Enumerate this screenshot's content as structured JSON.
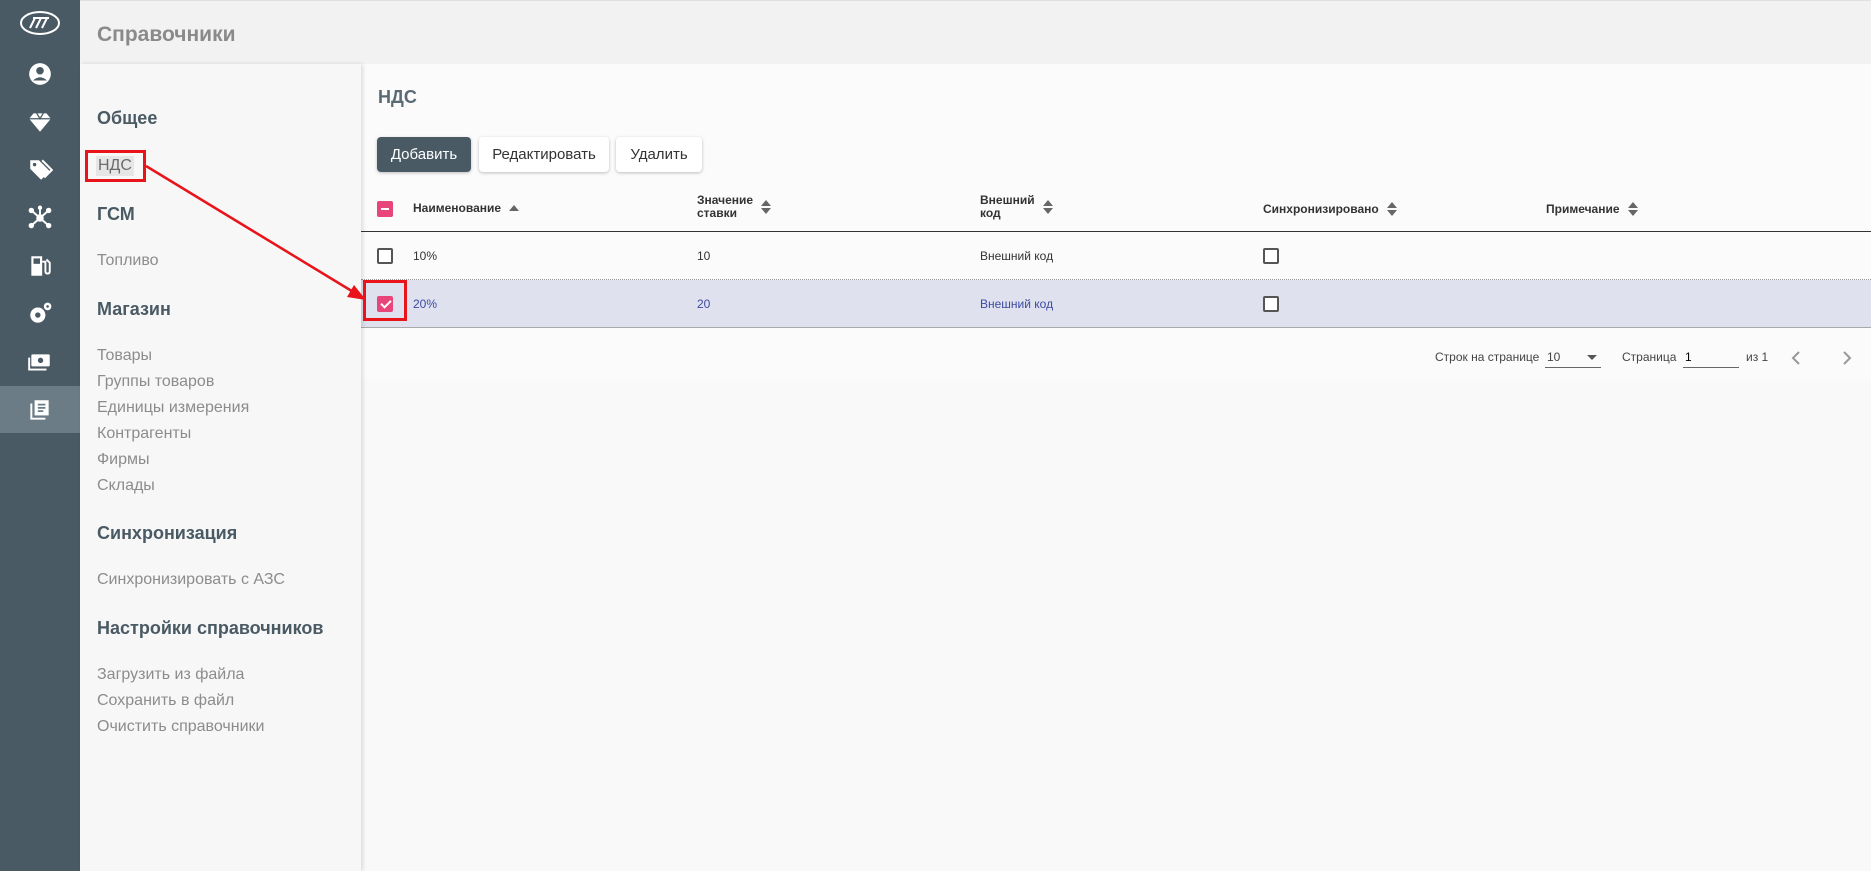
{
  "app": {
    "section_title": "Справочники"
  },
  "rail": {
    "icons": [
      "logo-icon",
      "user-icon",
      "diamond-icon",
      "tags-icon",
      "network-icon",
      "fuel-pump-icon",
      "gear-icon",
      "cash-icon",
      "reference-book-icon"
    ],
    "active": "reference-book-icon"
  },
  "menu": {
    "sections": [
      {
        "title": "Общее",
        "items": [
          "НДС"
        ]
      },
      {
        "title": "ГСМ",
        "items": [
          "Топливо"
        ]
      },
      {
        "title": "Магазин",
        "items": [
          "Товары",
          "Группы товаров",
          "Единицы измерения",
          "Контрагенты",
          "Фирмы",
          "Склады"
        ]
      },
      {
        "title": "Синхронизация",
        "items": [
          "Синхронизировать с АЗС"
        ]
      },
      {
        "title": "Настройки справочников",
        "items": [
          "Загрузить из файла",
          "Сохранить в файл",
          "Очистить справочники"
        ]
      }
    ],
    "selected_item": "НДС"
  },
  "page": {
    "title": "НДС",
    "buttons": {
      "add": "Добавить",
      "edit": "Редактировать",
      "delete": "Удалить"
    }
  },
  "table": {
    "columns": [
      {
        "line1": "Наименование",
        "line2": ""
      },
      {
        "line1": "Значение",
        "line2": "ставки"
      },
      {
        "line1": "Внешний",
        "line2": "код"
      },
      {
        "line1": "Синхронизировано",
        "line2": ""
      },
      {
        "line1": "Примечание",
        "line2": ""
      }
    ],
    "rows": [
      {
        "name": "10%",
        "rate": "10",
        "external_code": "Внешний код",
        "synced": false,
        "note": "",
        "selected": false
      },
      {
        "name": "20%",
        "rate": "20",
        "external_code": "Внешний код",
        "synced": false,
        "note": "",
        "selected": true
      }
    ]
  },
  "pager": {
    "rows_label": "Строк на странице",
    "rows_value": "10",
    "page_label": "Страница",
    "page_value": "1",
    "of_label": "из 1"
  },
  "colors": {
    "accent": "#4a5a64",
    "checkbox_selected": "#e8457a",
    "selected_row": "#dfe1ef",
    "annotation": "#e8141a"
  }
}
